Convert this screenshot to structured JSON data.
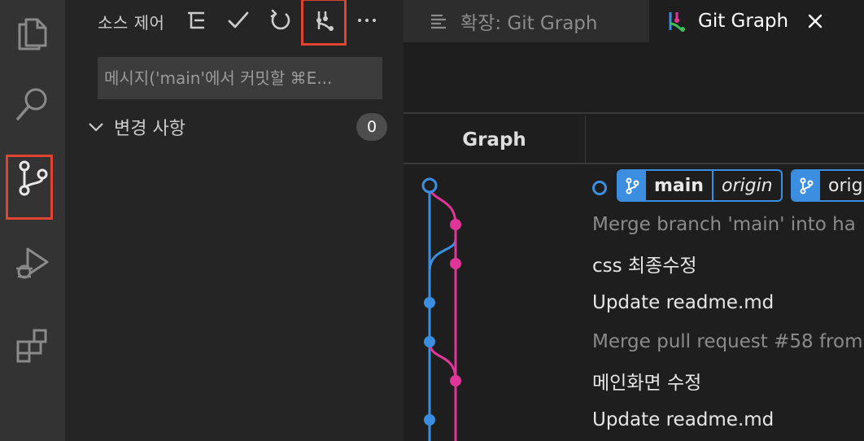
{
  "activity_bar": {
    "items": [
      {
        "name": "explorer",
        "icon": "files-icon"
      },
      {
        "name": "search",
        "icon": "search-icon"
      },
      {
        "name": "source-control",
        "icon": "source-control-icon"
      },
      {
        "name": "run-debug",
        "icon": "run-debug-icon"
      },
      {
        "name": "extensions",
        "icon": "extensions-icon"
      }
    ]
  },
  "sidebar": {
    "title": "소스 제어",
    "actions": [
      "tree-view-icon",
      "check-icon",
      "refresh-icon",
      "git-graph-icon",
      "more-icon"
    ],
    "commit_placeholder": "메시지('main'에서 커밋할 ⌘E...",
    "changes_label": "변경 사항",
    "changes_count": "0"
  },
  "tabs": [
    {
      "label": "확장: Git Graph",
      "active": false
    },
    {
      "label": "Git Graph",
      "active": true
    }
  ],
  "git_graph": {
    "column_graph": "Graph",
    "refs": [
      {
        "name": "main",
        "remote": "origin"
      },
      {
        "name": "orig",
        "remote": ""
      }
    ],
    "commits": [
      {
        "message": "Merge branch 'main' into ha",
        "dim": true
      },
      {
        "message": "css 최종수정",
        "dim": false
      },
      {
        "message": "Update readme.md",
        "dim": false
      },
      {
        "message": "Merge pull request #58 from",
        "dim": true
      },
      {
        "message": "메인화면 수정",
        "dim": false
      },
      {
        "message": "Update readme.md",
        "dim": false
      }
    ],
    "colors": {
      "branch_blue": "#3b8ee0",
      "branch_pink": "#e0369a"
    }
  },
  "highlight_color": "#e0432f"
}
